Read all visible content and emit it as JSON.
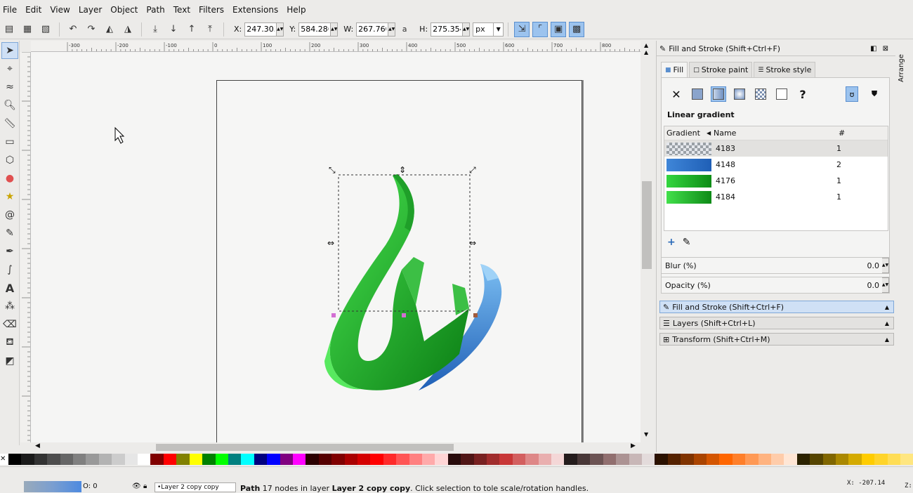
{
  "menu": [
    "File",
    "Edit",
    "View",
    "Layer",
    "Object",
    "Path",
    "Text",
    "Filters",
    "Extensions",
    "Help"
  ],
  "coords": {
    "x_label": "X:",
    "x": "247.303",
    "y_label": "Y:",
    "y": "584.286",
    "w_label": "W:",
    "w": "267.760",
    "h_label": "H:",
    "h": "275.354",
    "unit": "px"
  },
  "hruler_labels": [
    "-300",
    "-200",
    "-100",
    "0",
    "100",
    "200",
    "300",
    "400",
    "500",
    "600",
    "700",
    "800"
  ],
  "dock": {
    "title": "Fill and Stroke (Shift+Ctrl+F)",
    "tabs": [
      "Fill",
      "Stroke paint",
      "Stroke style"
    ],
    "paint_section": "Linear gradient",
    "columns": [
      "Gradient",
      "Name",
      "#"
    ],
    "gradients": [
      {
        "name": "4183",
        "count": "1",
        "c1": "#9aa0a6",
        "c2": "#e4e7ec"
      },
      {
        "name": "4148",
        "count": "2",
        "c1": "#3f86d8",
        "c2": "#1f5fb6"
      },
      {
        "name": "4176",
        "count": "1",
        "c1": "#33d63f",
        "c2": "#0d8c16"
      },
      {
        "name": "4184",
        "count": "1",
        "c1": "#42e04b",
        "c2": "#0e8a17"
      }
    ],
    "blur_label": "Blur (%)",
    "blur": "0.0",
    "opacity_label": "Opacity (%)",
    "opacity": "0.0",
    "panels": [
      "Fill and Stroke (Shift+Ctrl+F)",
      "Layers (Shift+Ctrl+L)",
      "Transform (Shift+Ctrl+M)"
    ],
    "side_tab": "Arrange"
  },
  "status": {
    "opacity_label": "O:",
    "opacity": "0",
    "layer": "•Layer 2 copy copy",
    "message_prefix": "Path",
    "message_a": " 17 nodes in layer ",
    "message_layer": "Layer 2 copy copy",
    "message_b": ". Click selection to to",
    "message_c": "le scale/rotation handles.",
    "cursor_x": "X: -207.14",
    "cursor_z": "Z:"
  },
  "palette": [
    "#000000",
    "#1a1a1a",
    "#333333",
    "#4d4d4d",
    "#666666",
    "#808080",
    "#999999",
    "#b3b3b3",
    "#cccccc",
    "#e6e6e6",
    "#ffffff",
    "#800000",
    "#ff0000",
    "#808000",
    "#ffff00",
    "#008000",
    "#00ff00",
    "#008080",
    "#00ffff",
    "#000080",
    "#0000ff",
    "#800080",
    "#ff00ff",
    "#2b0000",
    "#550000",
    "#800000",
    "#aa0000",
    "#d40000",
    "#ff0000",
    "#ff2a2a",
    "#ff5555",
    "#ff8080",
    "#ffaaaa",
    "#ffd5d5",
    "#280b0b",
    "#501616",
    "#782121",
    "#a02c2c",
    "#c83737",
    "#d35f5f",
    "#de8787",
    "#e9afaf",
    "#f4d7d7",
    "#241c1c",
    "#483737",
    "#6c5353",
    "#916f6f",
    "#ac9393",
    "#c8b7b7",
    "#e3dbdb",
    "#2b1100",
    "#552200",
    "#803300",
    "#aa4400",
    "#d45500",
    "#ff6600",
    "#ff7f2a",
    "#ff9955",
    "#ffb380",
    "#ffccaa",
    "#ffe6d5",
    "#2b2200",
    "#554400",
    "#806600",
    "#aa8800",
    "#d4aa00",
    "#ffcc00",
    "#ffd42a",
    "#ffdd55",
    "#ffe680"
  ]
}
